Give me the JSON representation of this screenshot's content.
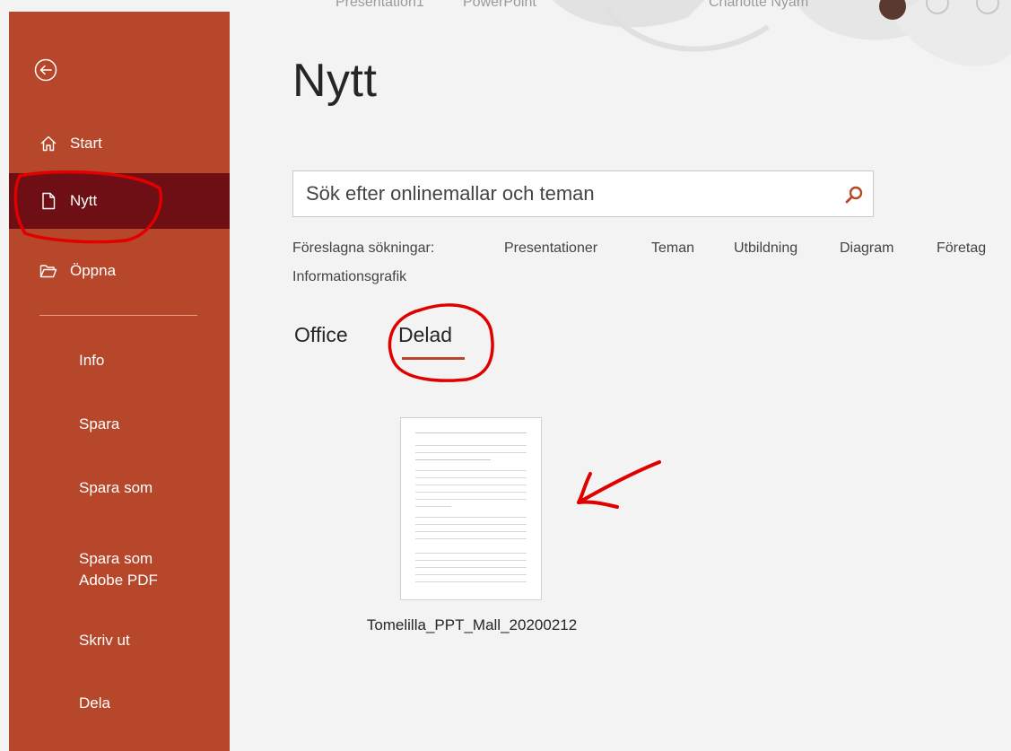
{
  "window": {
    "doc_name": "Presentation1",
    "app_name": "PowerPoint",
    "user_name": "Charlotte Nyam"
  },
  "sidebar": {
    "back_icon": "back-arrow-circle-icon",
    "items": [
      {
        "label": "Start",
        "icon": "home-icon"
      },
      {
        "label": "Nytt",
        "icon": "new-document-icon",
        "active": true
      },
      {
        "label": "Öppna",
        "icon": "open-folder-icon"
      },
      {
        "label": "Info"
      },
      {
        "label": "Spara"
      },
      {
        "label": "Spara som"
      },
      {
        "label": "Spara som\nAdobe PDF"
      },
      {
        "label": "Skriv ut"
      },
      {
        "label": "Dela"
      }
    ],
    "colors": {
      "background": "#b7472a",
      "active": "#6d0f14"
    }
  },
  "main": {
    "title": "Nytt",
    "search": {
      "placeholder": "Sök efter onlinemallar och teman",
      "value": "",
      "icon": "search-icon"
    },
    "suggestions": {
      "label": "Föreslagna sökningar:",
      "items": [
        "Presentationer",
        "Teman",
        "Utbildning",
        "Diagram",
        "Företag",
        "Informationsgrafik"
      ]
    },
    "tabs": [
      {
        "label": "Office"
      },
      {
        "label": "Delad",
        "selected": true
      }
    ],
    "templates": [
      {
        "name": "Tomelilla_PPT_Mall_20200212"
      }
    ]
  },
  "annotations": {
    "color": "#e00000"
  }
}
